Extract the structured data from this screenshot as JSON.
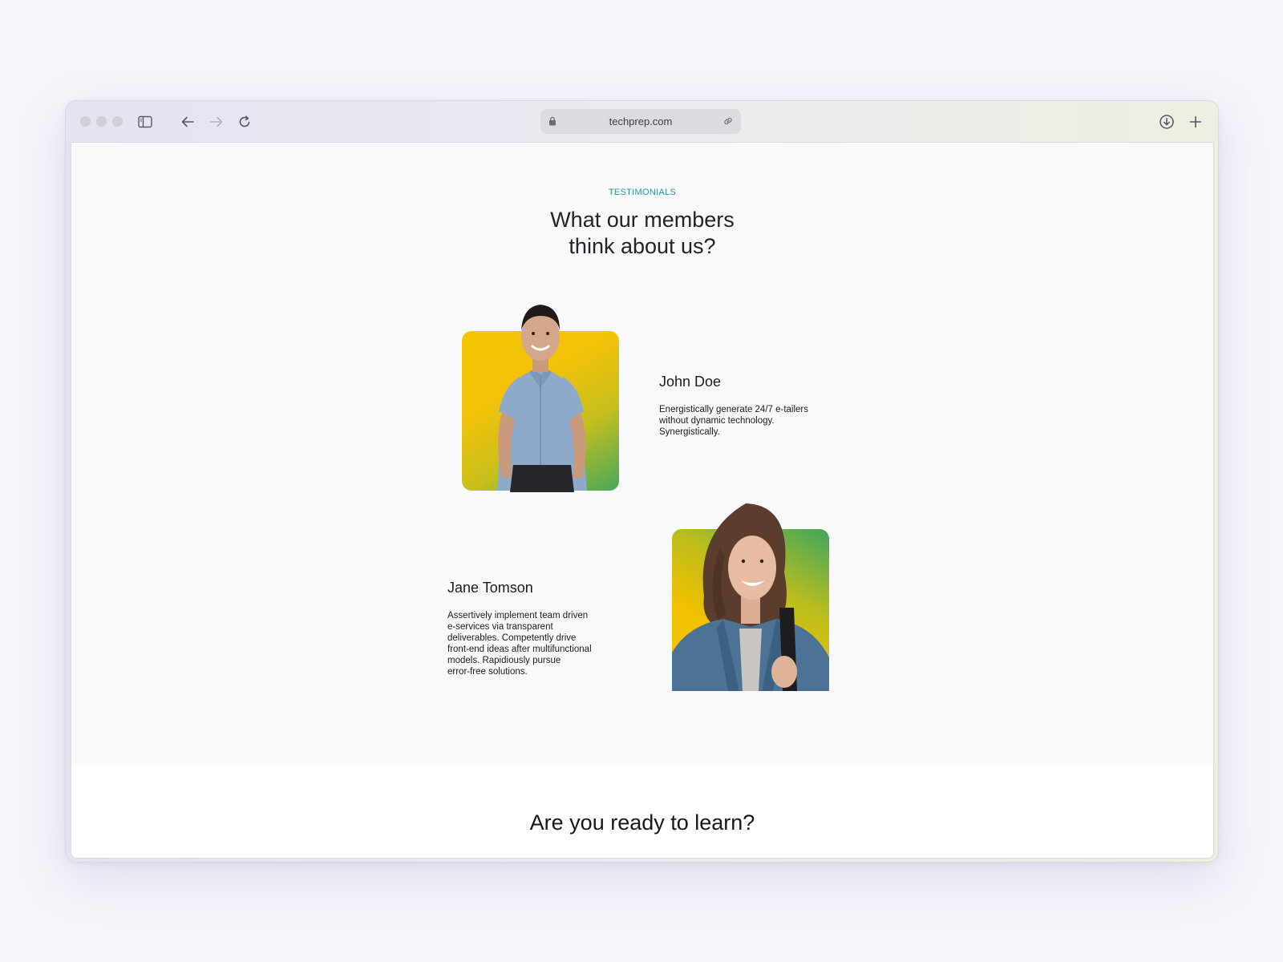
{
  "browser": {
    "url": "techprep.com",
    "icons": {
      "sidebar": "sidebar-icon",
      "back": "arrow-left-icon",
      "forward": "arrow-right-icon",
      "reload": "reload-icon",
      "lock": "lock-icon",
      "link": "link-icon",
      "download": "download-icon",
      "new_tab": "plus-icon"
    }
  },
  "testimonials": {
    "eyebrow": "TESTIMONIALS",
    "heading_line1": "What our members",
    "heading_line2": "think about us?",
    "items": [
      {
        "name": "John Doe",
        "quote_lines": [
          "Energistically generate 24/7 e-tailers",
          "without dynamic technology.",
          "Synergistically."
        ]
      },
      {
        "name": "Jane Tomson",
        "quote_lines": [
          "Assertively implement team driven",
          "e-services via transparent",
          "deliverables. Competently drive",
          "front-end ideas after multifunctional",
          "models. Rapidiously pursue",
          "error-free solutions."
        ]
      }
    ]
  },
  "cta": {
    "title": "Are you ready to learn?"
  },
  "colors": {
    "accent": "#1b9aa3",
    "card_yellow": "#f7c400",
    "card_green": "#3fa65e"
  }
}
